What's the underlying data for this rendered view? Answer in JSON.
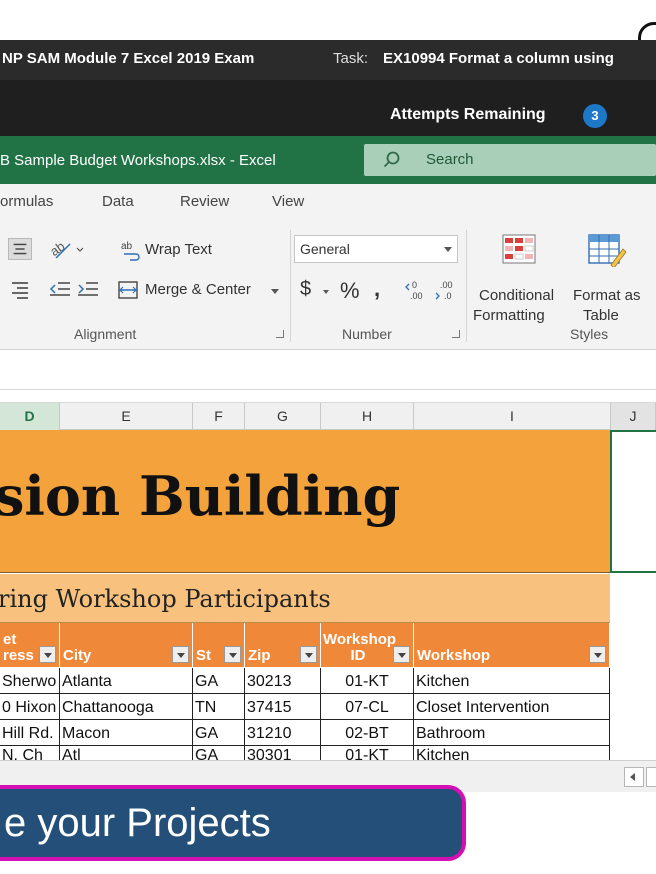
{
  "task_bar": {
    "module_title": "NP SAM Module 7 Excel 2019 Exam",
    "task_label": "Task:",
    "task_text": "EX10994 Format a column using"
  },
  "attempts": {
    "label": "Attempts Remaining",
    "count": "3"
  },
  "excel": {
    "file_title": "B Sample Budget Workshops.xlsx - Excel",
    "search_placeholder": "Search"
  },
  "ribbon_tabs": [
    "ormulas",
    "Data",
    "Review",
    "View"
  ],
  "ribbon": {
    "wrap_text": "Wrap Text",
    "merge_center": "Merge & Center",
    "number_format": "General",
    "currency": "$",
    "percent": "%",
    "comma": "١",
    "conditional_formatting_1": "Conditional",
    "conditional_formatting_2": "Formatting",
    "format_as_table_1": "Format as",
    "format_as_table_2": "Table",
    "group_alignment": "Alignment",
    "group_number": "Number",
    "group_styles": "Styles"
  },
  "columns": [
    "D",
    "E",
    "F",
    "G",
    "H",
    "I",
    "J"
  ],
  "sheet": {
    "title": "sion Building",
    "subtitle": "ring Workshop Participants",
    "headers": [
      {
        "line1": "et",
        "line2": "ress"
      },
      {
        "line1": "",
        "line2": "City"
      },
      {
        "line1": "",
        "line2": "St"
      },
      {
        "line1": "",
        "line2": "Zip"
      },
      {
        "line1": "Workshop",
        "line2": "ID"
      },
      {
        "line1": "",
        "line2": "Workshop"
      }
    ],
    "rows": [
      [
        "Sherwo",
        "Atlanta",
        "GA",
        "30213",
        "01-KT",
        "Kitchen"
      ],
      [
        "0 Hixon",
        "Chattanooga",
        "TN",
        "37415",
        "07-CL",
        "Closet Intervention"
      ],
      [
        "Hill Rd.",
        "Macon",
        "GA",
        "31210",
        "02-BT",
        "Bathroom"
      ],
      [
        "N. Ch",
        "Atl",
        "GA",
        "30301",
        "01-KT",
        "Kitchen"
      ]
    ]
  },
  "promo": {
    "text": "e your Projects"
  },
  "colors": {
    "excel_green": "#217346",
    "title_band": "#f4a23c",
    "subtitle_band": "#f8c27e",
    "table_header": "#f0883a",
    "promo_bg": "#234f78",
    "promo_border": "#d40fb3",
    "attempts_badge": "#1e78c8"
  }
}
